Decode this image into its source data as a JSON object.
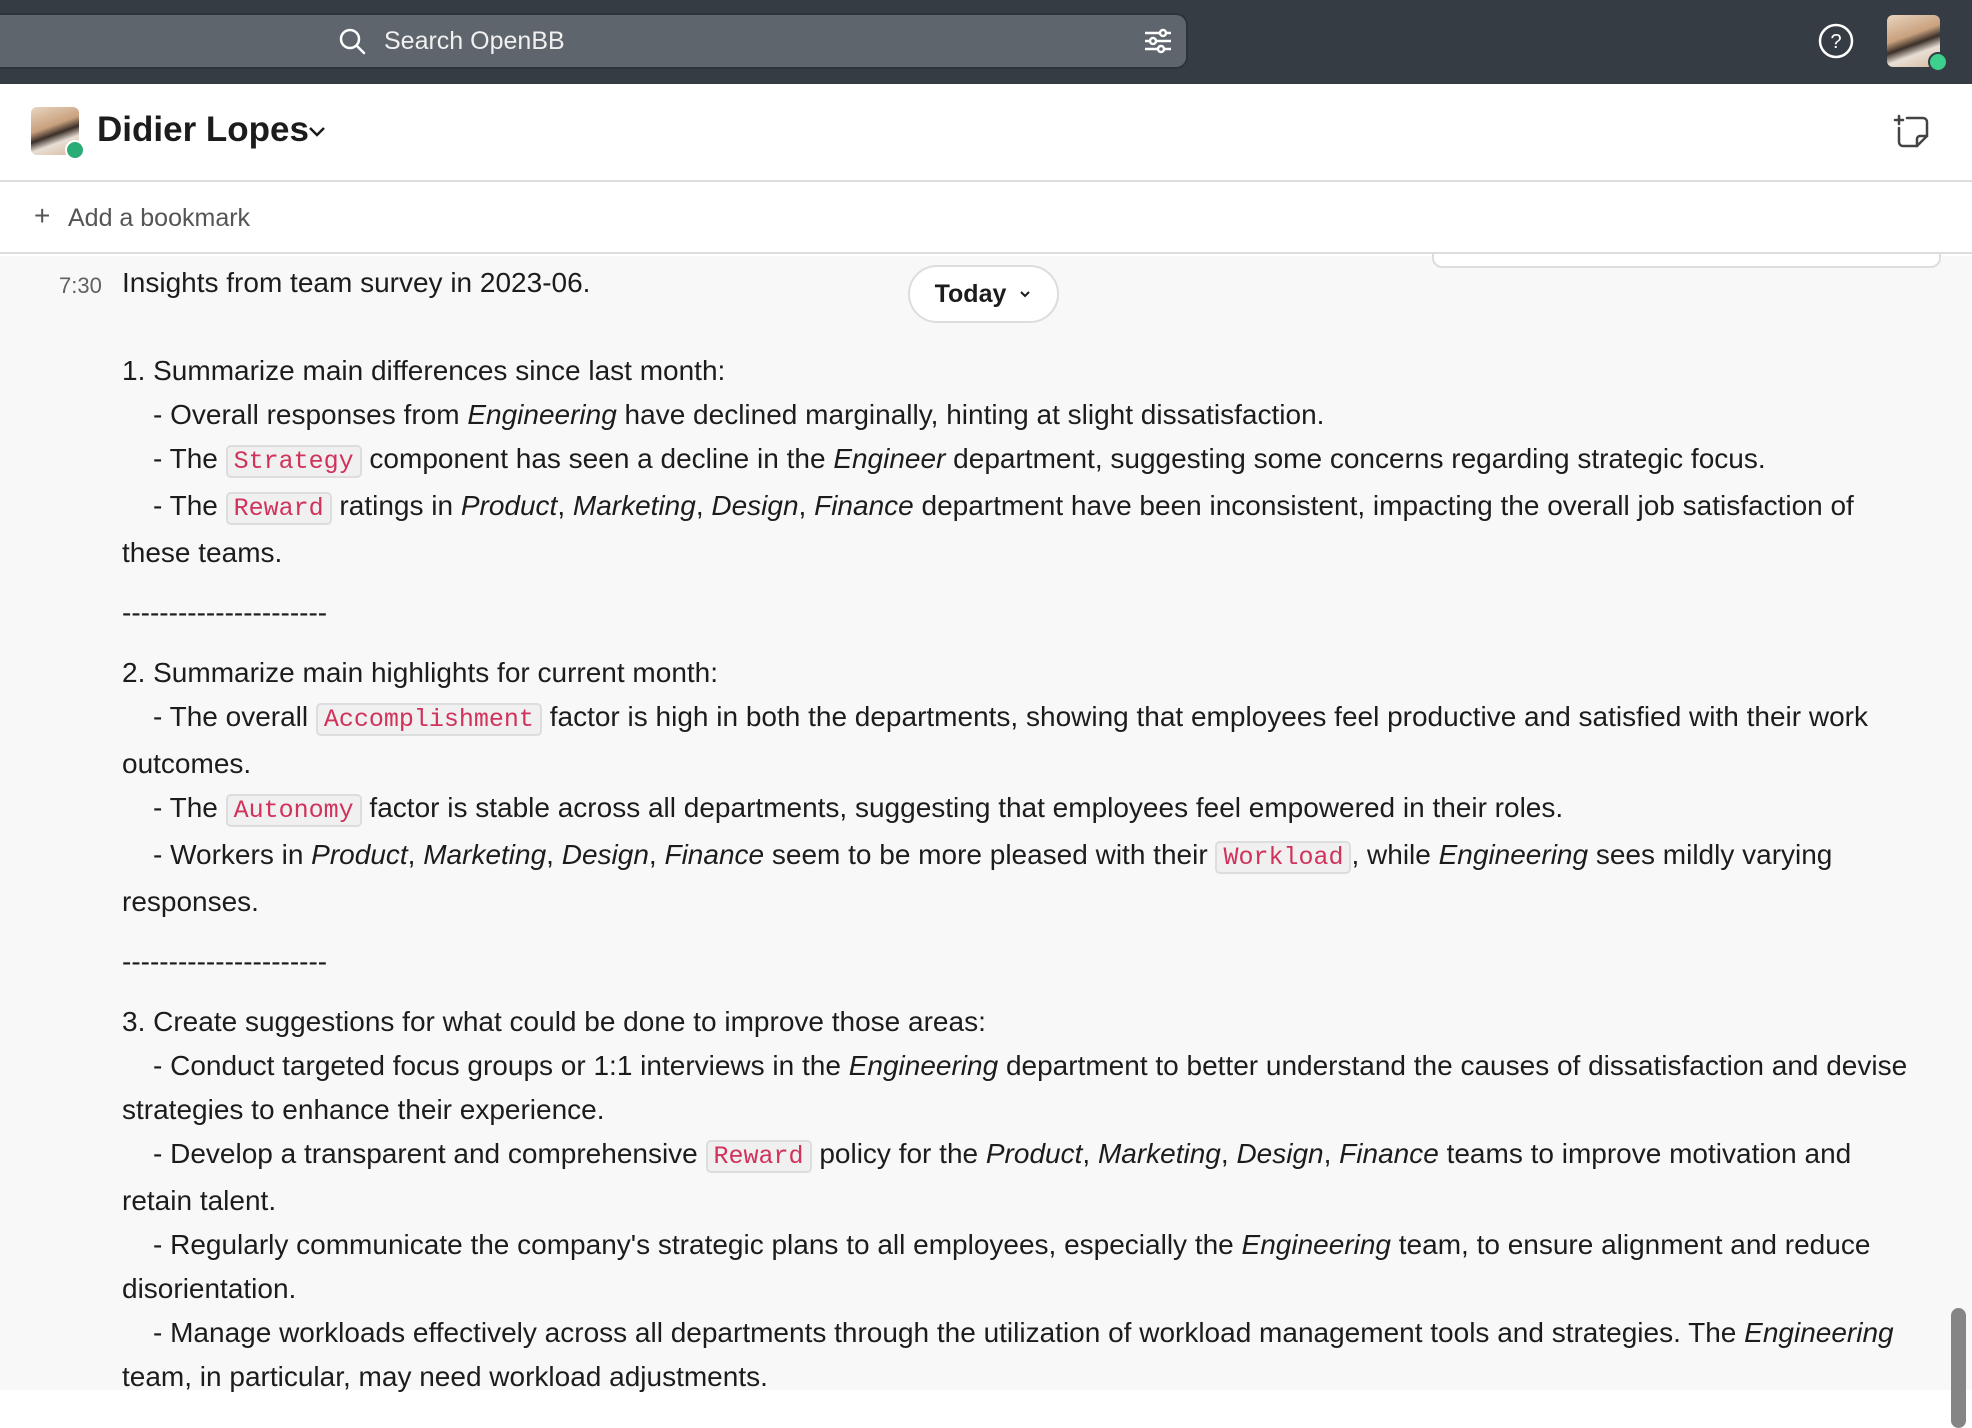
{
  "topbar": {
    "search_placeholder": "Search OpenBB",
    "icons": [
      "search-icon",
      "filter-icon",
      "help-icon",
      "avatar"
    ]
  },
  "header": {
    "channel_name": "Didier Lopes",
    "status_color": "#2bac76"
  },
  "bookmarks": {
    "add_label": "Add a bookmark"
  },
  "message": {
    "time": "7:30",
    "date_divider": "Today",
    "paragraphs": [
      {
        "type": "title",
        "segments": [
          {
            "t": "Insights from team survey in 2023-06."
          }
        ]
      },
      {
        "type": "heading",
        "segments": [
          {
            "t": "1. Summarize main differences since last month:"
          }
        ]
      },
      {
        "type": "bullet",
        "segments": [
          {
            "t": "- Overall responses from "
          },
          {
            "t": "Engineering",
            "s": "it"
          },
          {
            "t": " have declined marginally, hinting at slight dissatisfaction."
          }
        ]
      },
      {
        "type": "bullet",
        "segments": [
          {
            "t": "- The "
          },
          {
            "t": "Strategy",
            "s": "code"
          },
          {
            "t": " component has seen a decline in the "
          },
          {
            "t": "Engineer",
            "s": "it"
          },
          {
            "t": " department, suggesting some concerns regarding strategic focus."
          }
        ]
      },
      {
        "type": "bullet",
        "segments": [
          {
            "t": "- The "
          },
          {
            "t": "Reward",
            "s": "code"
          },
          {
            "t": " ratings in "
          },
          {
            "t": "Product",
            "s": "it"
          },
          {
            "t": ", "
          },
          {
            "t": "Marketing",
            "s": "it"
          },
          {
            "t": ", "
          },
          {
            "t": "Design",
            "s": "it"
          },
          {
            "t": ", "
          },
          {
            "t": "Finance",
            "s": "it"
          },
          {
            "t": " department have been inconsistent, impacting the overall job satisfaction of these teams."
          }
        ]
      },
      {
        "type": "divider",
        "segments": [
          {
            "t": "----------------------"
          }
        ]
      },
      {
        "type": "heading",
        "segments": [
          {
            "t": "2. Summarize main highlights for current month:"
          }
        ]
      },
      {
        "type": "bullet",
        "segments": [
          {
            "t": "- The overall "
          },
          {
            "t": "Accomplishment",
            "s": "code"
          },
          {
            "t": " factor is high in both the departments, showing that employees feel productive and satisfied with their work outcomes."
          }
        ]
      },
      {
        "type": "bullet",
        "segments": [
          {
            "t": "- The "
          },
          {
            "t": "Autonomy",
            "s": "code"
          },
          {
            "t": " factor is stable across all departments, suggesting that employees feel empowered in their roles."
          }
        ]
      },
      {
        "type": "bullet",
        "segments": [
          {
            "t": "- Workers in "
          },
          {
            "t": "Product",
            "s": "it"
          },
          {
            "t": ", "
          },
          {
            "t": "Marketing",
            "s": "it"
          },
          {
            "t": ", "
          },
          {
            "t": "Design",
            "s": "it"
          },
          {
            "t": ", "
          },
          {
            "t": "Finance",
            "s": "it"
          },
          {
            "t": " seem to be more pleased with their "
          },
          {
            "t": "Workload",
            "s": "code"
          },
          {
            "t": ", while "
          },
          {
            "t": "Engineering",
            "s": "it"
          },
          {
            "t": " sees mildly varying responses."
          }
        ]
      },
      {
        "type": "divider",
        "segments": [
          {
            "t": "----------------------"
          }
        ]
      },
      {
        "type": "heading",
        "segments": [
          {
            "t": "3. Create suggestions for what could be done to improve those areas:"
          }
        ]
      },
      {
        "type": "bullet",
        "segments": [
          {
            "t": "- Conduct targeted focus groups or 1:1 interviews in the "
          },
          {
            "t": "Engineering",
            "s": "it"
          },
          {
            "t": " department to better understand the causes of dissatisfaction and devise strategies to enhance their experience."
          }
        ]
      },
      {
        "type": "bullet",
        "segments": [
          {
            "t": "- Develop a transparent and comprehensive "
          },
          {
            "t": "Reward",
            "s": "code"
          },
          {
            "t": " policy for the "
          },
          {
            "t": "Product",
            "s": "it"
          },
          {
            "t": ", "
          },
          {
            "t": "Marketing",
            "s": "it"
          },
          {
            "t": ", "
          },
          {
            "t": "Design",
            "s": "it"
          },
          {
            "t": ", "
          },
          {
            "t": "Finance",
            "s": "it"
          },
          {
            "t": " teams to improve motivation and retain talent."
          }
        ]
      },
      {
        "type": "bullet",
        "segments": [
          {
            "t": "- Regularly communicate the company's strategic plans to all employees, especially the "
          },
          {
            "t": "Engineering",
            "s": "it"
          },
          {
            "t": " team, to ensure alignment and reduce disorientation."
          }
        ]
      },
      {
        "type": "bullet",
        "segments": [
          {
            "t": "- Manage workloads effectively across all departments through the utilization of workload management tools and strategies. The "
          },
          {
            "t": "Engineering",
            "s": "it"
          },
          {
            "t": " team, in particular, may need workload adjustments."
          }
        ]
      }
    ]
  }
}
